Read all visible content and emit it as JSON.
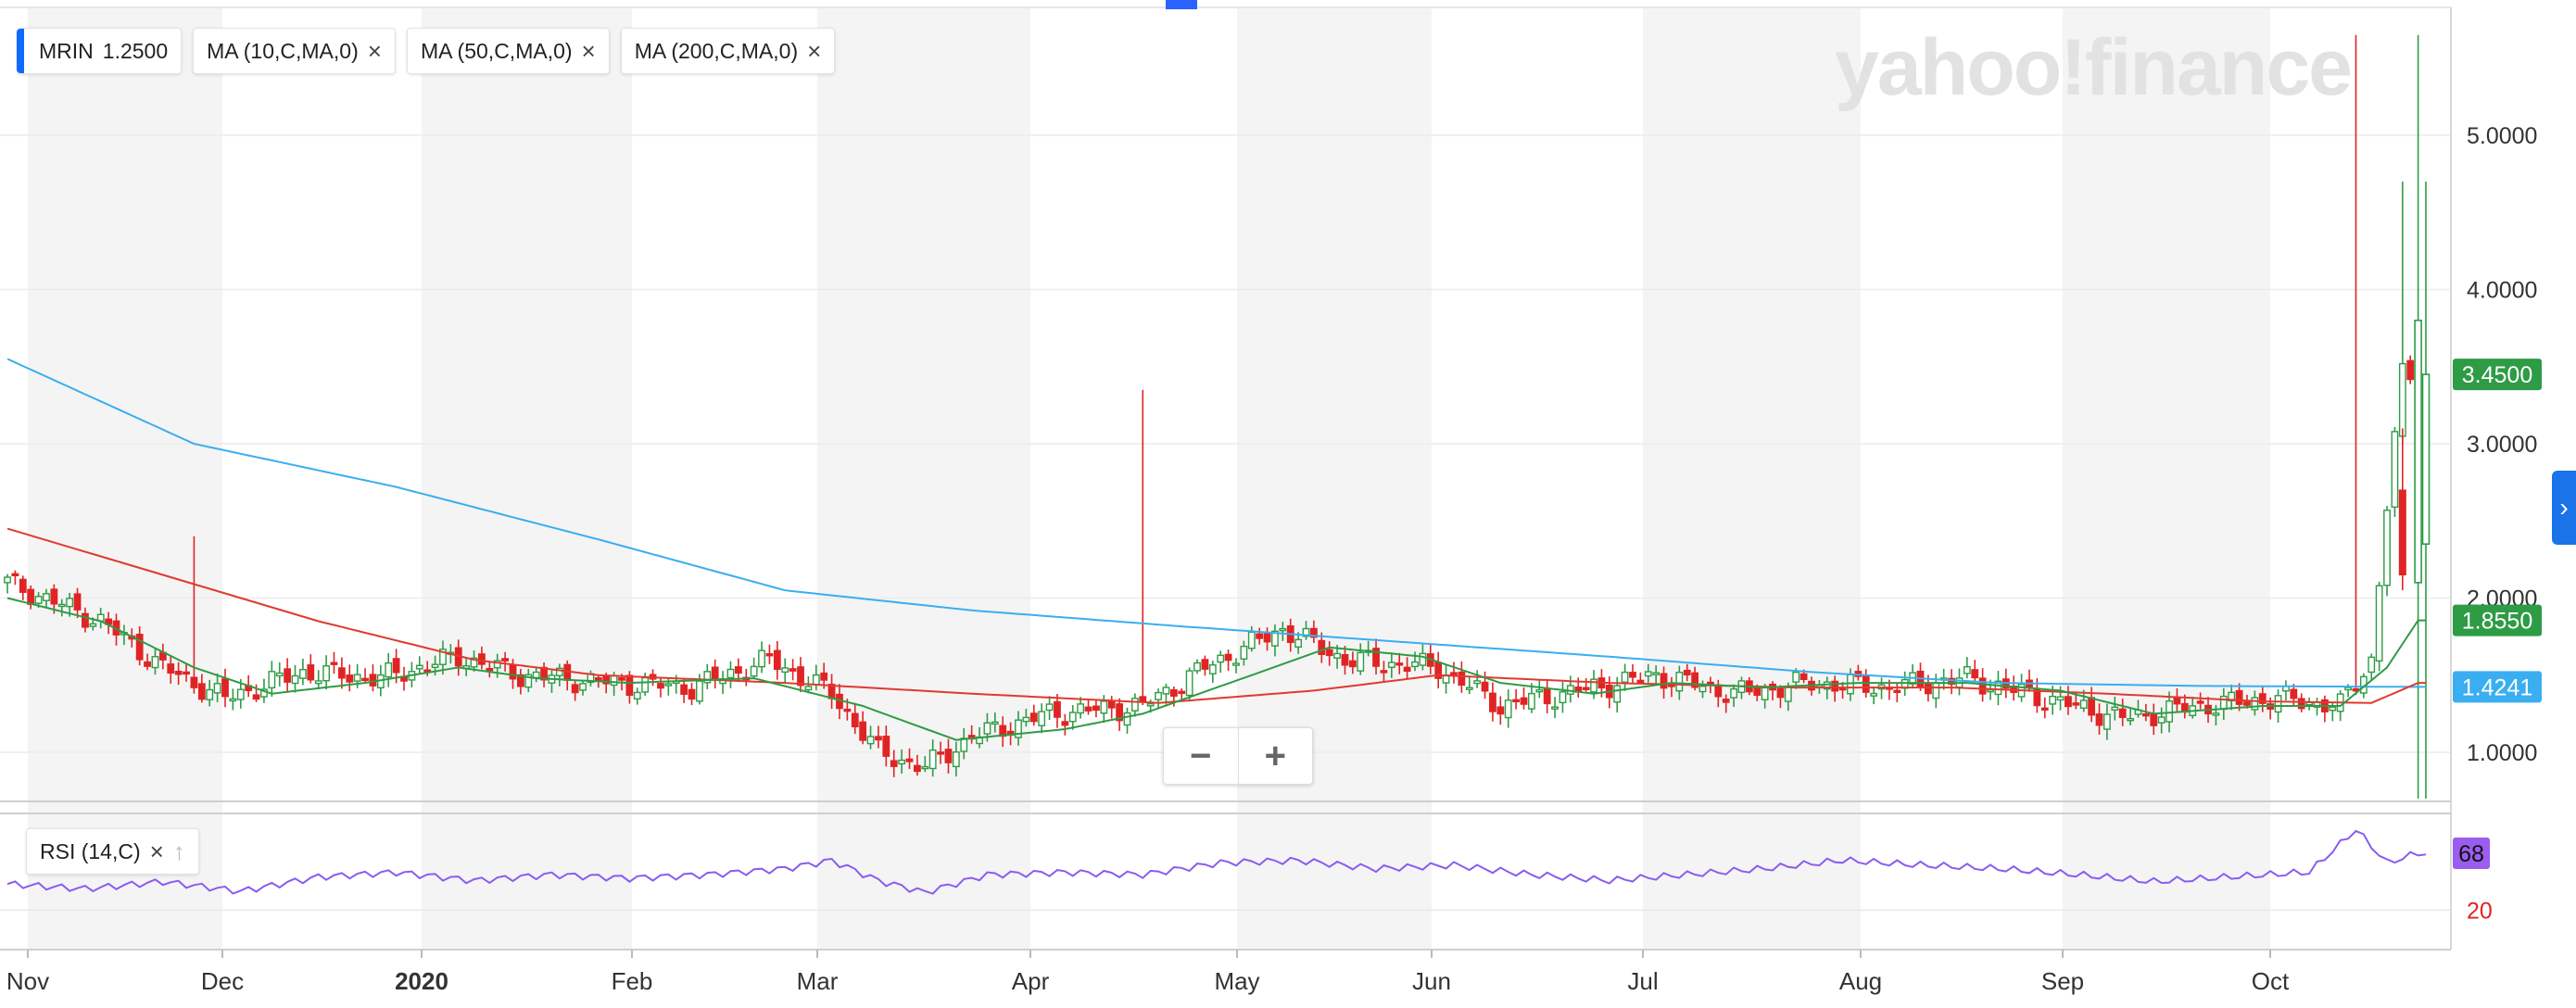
{
  "watermark": "yahoo!finance",
  "legend": {
    "symbol": "MRIN",
    "price": "1.2500",
    "ma10": "MA (10,C,MA,0)",
    "ma50": "MA (50,C,MA,0)",
    "ma200": "MA (200,C,MA,0)",
    "close_glyph": "×"
  },
  "rsi_legend": {
    "label": "RSI (14,C)",
    "close_glyph": "×",
    "up_glyph": "↑"
  },
  "zoom": {
    "minus": "−",
    "plus": "+"
  },
  "colors": {
    "up": "#2e9b45",
    "down": "#e02424",
    "ma10": "#2e9b45",
    "ma50": "#e03a2f",
    "ma200": "#3aaef0",
    "rsi": "#8a5cf0",
    "accent": "#0f69ff",
    "alt_band": "#f4f4f4"
  },
  "chart_data": [
    {
      "type": "candlestick",
      "symbol": "MRIN",
      "x_ticks": [
        "Nov",
        "Dec",
        "2020",
        "Feb",
        "Mar",
        "Apr",
        "May",
        "Jun",
        "Jul",
        "Aug",
        "Sep",
        "Oct"
      ],
      "y_ticks": [
        "5.0000",
        "4.0000",
        "3.0000",
        "2.0000",
        "1.0000"
      ],
      "ylim": [
        0.7,
        5.8
      ],
      "price_labels": {
        "last": "3.4500",
        "ma10": "1.8550",
        "ma200": "1.4241"
      },
      "close_anchors": [
        [
          0,
          2.1
        ],
        [
          12,
          1.85
        ],
        [
          20,
          1.55
        ],
        [
          28,
          1.35
        ],
        [
          38,
          1.52
        ],
        [
          48,
          1.48
        ],
        [
          58,
          1.62
        ],
        [
          66,
          1.5
        ],
        [
          78,
          1.45
        ],
        [
          88,
          1.42
        ],
        [
          98,
          1.6
        ],
        [
          106,
          1.38
        ],
        [
          112,
          1.0
        ],
        [
          118,
          0.9
        ],
        [
          124,
          1.1
        ],
        [
          134,
          1.25
        ],
        [
          146,
          1.3
        ],
        [
          154,
          1.55
        ],
        [
          164,
          1.8
        ],
        [
          172,
          1.6
        ],
        [
          184,
          1.55
        ],
        [
          192,
          1.3
        ],
        [
          202,
          1.4
        ],
        [
          212,
          1.5
        ],
        [
          222,
          1.38
        ],
        [
          232,
          1.45
        ],
        [
          242,
          1.42
        ],
        [
          252,
          1.48
        ],
        [
          262,
          1.35
        ],
        [
          272,
          1.22
        ],
        [
          282,
          1.3
        ],
        [
          292,
          1.35
        ],
        [
          300,
          1.3
        ],
        [
          304,
          1.6
        ],
        [
          306,
          2.6
        ],
        [
          308,
          3.45
        ]
      ],
      "spikes": [
        {
          "index": 24,
          "high": 2.4
        },
        {
          "index": 146,
          "high": 3.35
        },
        {
          "index": 302,
          "high": 5.65
        },
        {
          "index": 308,
          "high": 4.7
        }
      ],
      "ma10_anchors": [
        [
          0,
          2.0
        ],
        [
          12,
          1.85
        ],
        [
          24,
          1.55
        ],
        [
          34,
          1.38
        ],
        [
          46,
          1.45
        ],
        [
          58,
          1.55
        ],
        [
          68,
          1.48
        ],
        [
          80,
          1.45
        ],
        [
          96,
          1.48
        ],
        [
          110,
          1.3
        ],
        [
          122,
          1.08
        ],
        [
          136,
          1.15
        ],
        [
          146,
          1.25
        ],
        [
          160,
          1.5
        ],
        [
          170,
          1.68
        ],
        [
          182,
          1.62
        ],
        [
          192,
          1.45
        ],
        [
          204,
          1.38
        ],
        [
          214,
          1.45
        ],
        [
          226,
          1.42
        ],
        [
          238,
          1.45
        ],
        [
          252,
          1.45
        ],
        [
          264,
          1.4
        ],
        [
          276,
          1.25
        ],
        [
          290,
          1.3
        ],
        [
          300,
          1.3
        ],
        [
          306,
          1.55
        ],
        [
          310,
          1.855
        ]
      ],
      "ma50_anchors": [
        [
          0,
          2.45
        ],
        [
          20,
          2.15
        ],
        [
          40,
          1.85
        ],
        [
          60,
          1.6
        ],
        [
          76,
          1.5
        ],
        [
          100,
          1.45
        ],
        [
          124,
          1.38
        ],
        [
          148,
          1.32
        ],
        [
          168,
          1.4
        ],
        [
          184,
          1.5
        ],
        [
          206,
          1.45
        ],
        [
          230,
          1.42
        ],
        [
          250,
          1.42
        ],
        [
          270,
          1.38
        ],
        [
          290,
          1.33
        ],
        [
          304,
          1.32
        ],
        [
          310,
          1.45
        ]
      ],
      "ma200_anchors": [
        [
          0,
          3.55
        ],
        [
          24,
          3.0
        ],
        [
          50,
          2.72
        ],
        [
          76,
          2.38
        ],
        [
          100,
          2.05
        ],
        [
          124,
          1.92
        ],
        [
          150,
          1.82
        ],
        [
          178,
          1.72
        ],
        [
          206,
          1.62
        ],
        [
          232,
          1.52
        ],
        [
          256,
          1.45
        ],
        [
          282,
          1.43
        ],
        [
          310,
          1.4241
        ]
      ]
    },
    {
      "type": "line",
      "name": "RSI (14,C)",
      "y_ticks": [
        "20"
      ],
      "last_label": "68",
      "ylim": [
        0,
        100
      ],
      "anchors": [
        [
          0,
          42
        ],
        [
          10,
          38
        ],
        [
          20,
          44
        ],
        [
          30,
          36
        ],
        [
          40,
          48
        ],
        [
          50,
          52
        ],
        [
          60,
          45
        ],
        [
          70,
          50
        ],
        [
          80,
          47
        ],
        [
          90,
          50
        ],
        [
          100,
          55
        ],
        [
          106,
          62
        ],
        [
          112,
          45
        ],
        [
          118,
          35
        ],
        [
          126,
          50
        ],
        [
          136,
          52
        ],
        [
          146,
          50
        ],
        [
          156,
          60
        ],
        [
          166,
          62
        ],
        [
          176,
          55
        ],
        [
          186,
          58
        ],
        [
          196,
          50
        ],
        [
          206,
          45
        ],
        [
          216,
          50
        ],
        [
          226,
          55
        ],
        [
          236,
          62
        ],
        [
          246,
          58
        ],
        [
          256,
          55
        ],
        [
          266,
          50
        ],
        [
          276,
          44
        ],
        [
          286,
          48
        ],
        [
          296,
          52
        ],
        [
          302,
          88
        ],
        [
          306,
          60
        ],
        [
          310,
          68
        ]
      ]
    }
  ]
}
